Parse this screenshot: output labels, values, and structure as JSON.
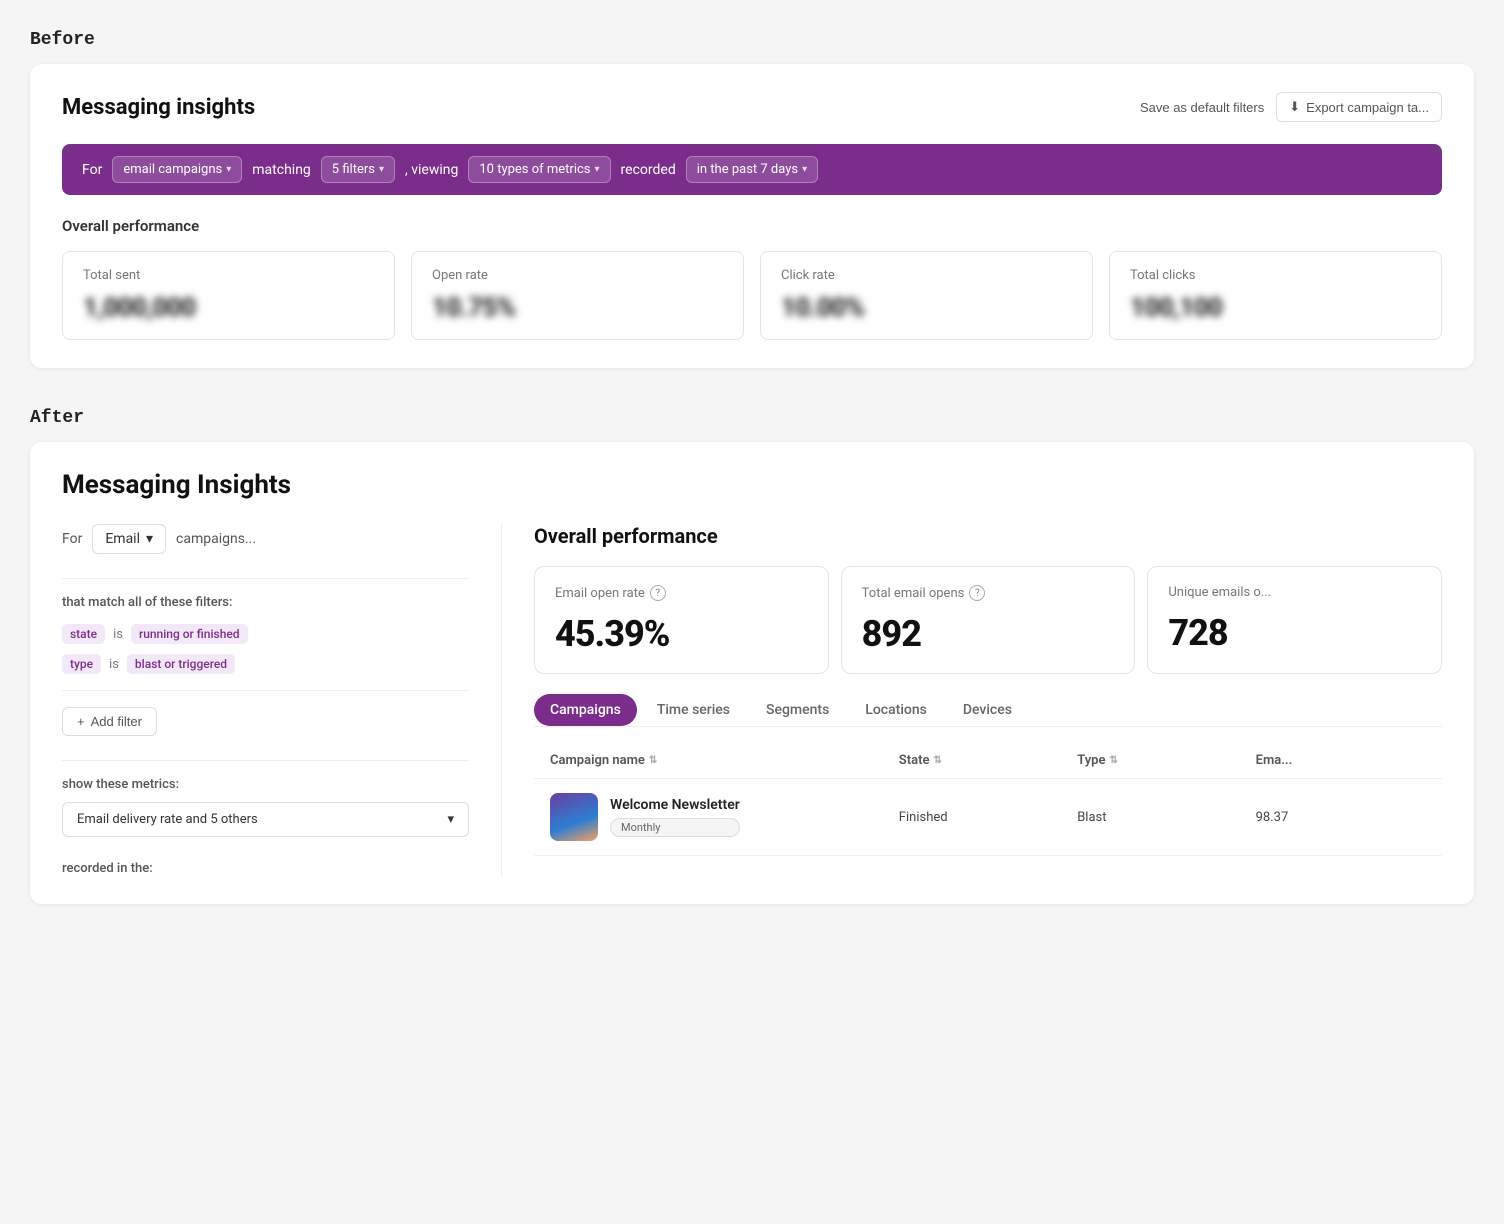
{
  "before": {
    "section_label": "Before",
    "title": "Messaging insights",
    "save_btn": "Save as default filters",
    "export_btn": "Export campaign ta...",
    "filter_for": "For",
    "filter_email_campaigns": "email campaigns",
    "filter_matching": "matching",
    "filter_5_filters": "5 filters",
    "filter_viewing": ", viewing",
    "filter_10_types": "10 types of metrics",
    "filter_recorded": "recorded",
    "filter_past_days": "in the past 7 days",
    "perf_title": "Overall performance",
    "metrics": [
      {
        "label": "Total sent",
        "value": "1,000,000"
      },
      {
        "label": "Open rate",
        "value": "10.75%"
      },
      {
        "label": "Click rate",
        "value": "10.00%"
      },
      {
        "label": "Total clicks",
        "value": "100,100"
      }
    ]
  },
  "after": {
    "section_label": "After",
    "title": "Messaging Insights",
    "for_label": "For",
    "email_select": "Email",
    "campaigns_text": "campaigns...",
    "match_title": "that match all of these filters:",
    "filters": [
      {
        "key": "state",
        "operator": "is",
        "value": "running or finished"
      },
      {
        "key": "type",
        "operator": "is",
        "value": "blast or triggered"
      }
    ],
    "add_filter_btn": "+ Add filter",
    "metrics_title": "show these metrics:",
    "metrics_select": "Email delivery rate and 5 others",
    "recorded_title": "recorded in the:",
    "overall_perf_title": "Overall performance",
    "metric_cards": [
      {
        "label": "Email open rate",
        "value": "45.39%",
        "has_help": true
      },
      {
        "label": "Total email opens",
        "value": "892",
        "has_help": true
      },
      {
        "label": "Unique emails o...",
        "value": "728",
        "has_help": false
      }
    ],
    "tabs": [
      {
        "label": "Campaigns",
        "active": true
      },
      {
        "label": "Time series",
        "active": false
      },
      {
        "label": "Segments",
        "active": false
      },
      {
        "label": "Locations",
        "active": false
      },
      {
        "label": "Devices",
        "active": false
      }
    ],
    "table_headers": [
      {
        "label": "Campaign name",
        "sortable": true
      },
      {
        "label": "State",
        "sortable": true
      },
      {
        "label": "Type",
        "sortable": true
      },
      {
        "label": "Ema...",
        "sortable": false
      }
    ],
    "table_rows": [
      {
        "name": "Welcome Newsletter",
        "badge": "Monthly",
        "state": "Finished",
        "type": "Blast",
        "email_val": "98.37"
      }
    ]
  },
  "icons": {
    "chevron_down": "▾",
    "export": "⬇",
    "sort": "⇅",
    "help": "?",
    "plus": "+"
  }
}
